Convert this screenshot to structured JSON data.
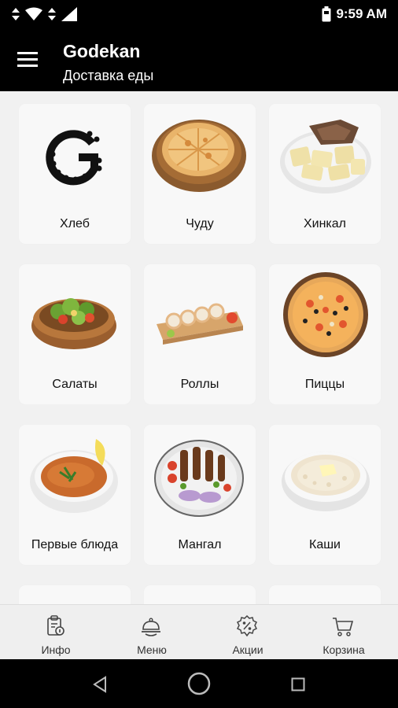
{
  "status_bar": {
    "time": "9:59 AM"
  },
  "app_bar": {
    "title": "Godekan",
    "subtitle": "Доставка еды"
  },
  "categories": [
    {
      "label": "Хлеб",
      "icon": "godekan-logo-icon"
    },
    {
      "label": "Чуду",
      "icon": "chudu-image"
    },
    {
      "label": "Хинкал",
      "icon": "khinkal-image"
    },
    {
      "label": "Салаты",
      "icon": "salad-image"
    },
    {
      "label": "Роллы",
      "icon": "rolls-image"
    },
    {
      "label": "Пиццы",
      "icon": "pizza-image"
    },
    {
      "label": "Первые блюда",
      "icon": "soup-image"
    },
    {
      "label": "Мангал",
      "icon": "grill-image"
    },
    {
      "label": "Каши",
      "icon": "porridge-image"
    }
  ],
  "bottom_nav": [
    {
      "label": "Инфо",
      "icon": "info-clipboard-icon"
    },
    {
      "label": "Меню",
      "icon": "menu-cloche-icon"
    },
    {
      "label": "Акции",
      "icon": "percent-badge-icon"
    },
    {
      "label": "Корзина",
      "icon": "cart-icon"
    }
  ],
  "colors": {
    "app_bar": "#000000",
    "background": "#f1f1f1",
    "card": "#f8f8f8",
    "text": "#111111"
  }
}
